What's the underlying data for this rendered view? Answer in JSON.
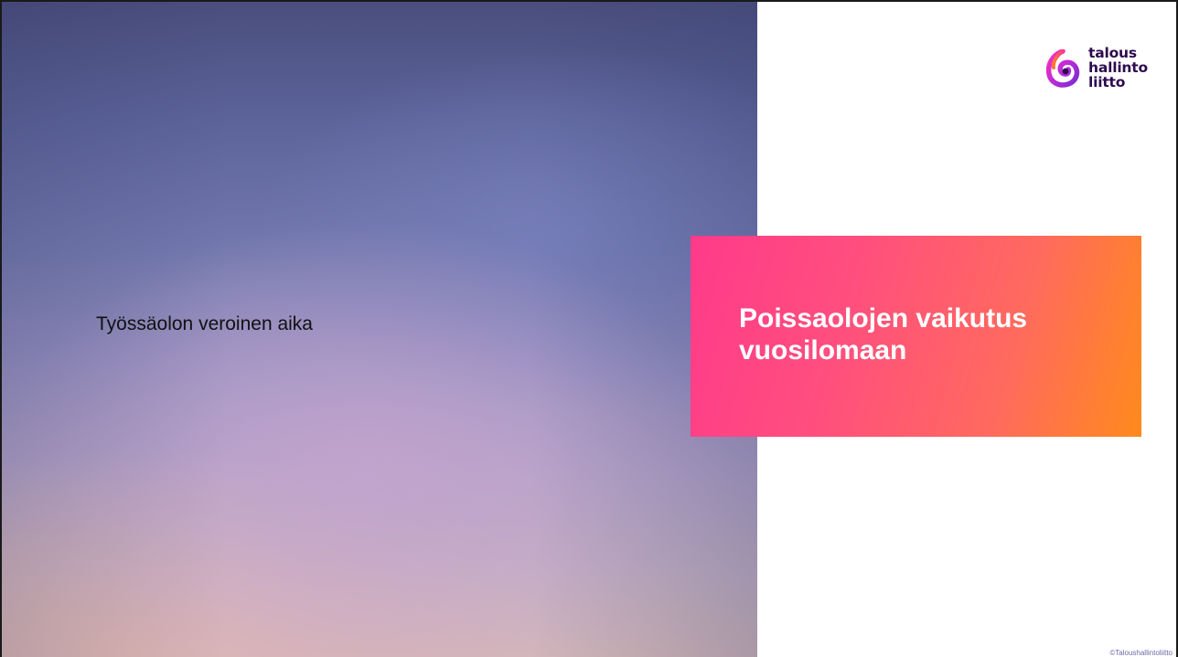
{
  "slide": {
    "subtitle": "Työssäolon veroinen aika",
    "title_line1": "Poissaolojen vaikutus",
    "title_line2": "vuosilomaan",
    "copyright": "©Taloushallintoliitto"
  },
  "logo": {
    "icon": "talous-hallinto-liitto-spiral-logo",
    "line1": "talous",
    "line2": "hallinto",
    "line3": "liitto"
  },
  "colors": {
    "title_box_start": "#ff3a8a",
    "title_box_end": "#ff8a1c",
    "logo_text": "#2d0a4e"
  }
}
